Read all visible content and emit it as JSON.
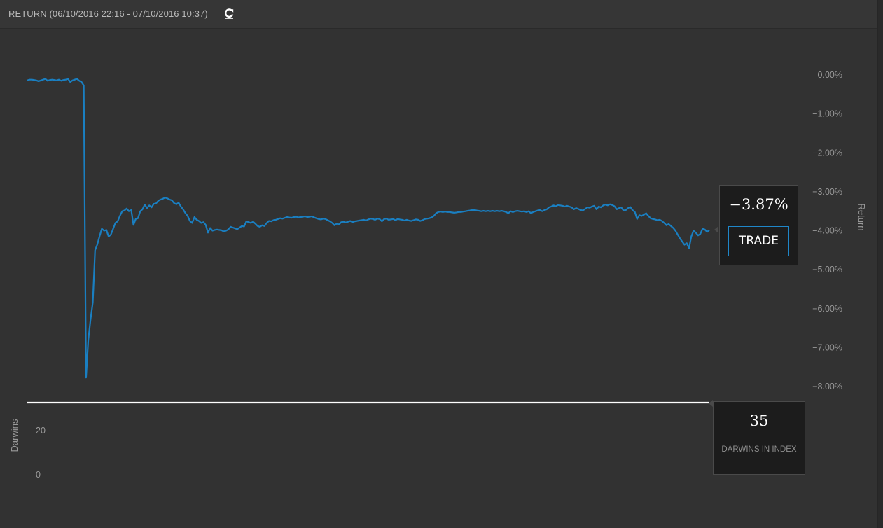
{
  "header": {
    "title": "RETURN (06/10/2016 22:16 - 07/10/2016 10:37)",
    "refresh_icon": "refresh-icon"
  },
  "return_box": {
    "value": "−3.87%",
    "trade_label": "TRADE"
  },
  "darwins_box": {
    "count": "35",
    "label": "DARWINS IN INDEX"
  },
  "colors": {
    "line": "#1a7fc1",
    "background": "#323232",
    "darwins_line": "#ffffff"
  },
  "chart_data": [
    {
      "type": "line",
      "ylabel": "Return",
      "ylim": [
        -8,
        0
      ],
      "y_ticks": [
        "0.00%",
        "−1.00%",
        "−2.00%",
        "−3.00%",
        "−4.00%",
        "−5.00%",
        "−6.00%",
        "−7.00%",
        "−8.00%"
      ],
      "y_tick_values": [
        0,
        -1,
        -2,
        -3,
        -4,
        -5,
        -6,
        -7,
        -8
      ],
      "grid": false,
      "series": [
        {
          "values": [
            -0.14,
            -0.12,
            -0.12,
            -0.13,
            -0.14,
            -0.16,
            -0.14,
            -0.12,
            -0.1,
            -0.15,
            -0.13,
            -0.12,
            -0.13,
            -0.14,
            -0.12,
            -0.15,
            -0.13,
            -0.12,
            -0.1,
            -0.18,
            -0.14,
            -0.12,
            -0.1,
            -0.15,
            -0.18,
            -0.27,
            -7.77,
            -6.8,
            -6.28,
            -5.84,
            -4.5,
            -4.35,
            -4.14,
            -3.95,
            -4.0,
            -3.98,
            -4.15,
            -4.1,
            -3.95,
            -3.8,
            -3.76,
            -3.62,
            -3.5,
            -3.48,
            -3.43,
            -3.5,
            -3.47,
            -3.85,
            -3.7,
            -3.68,
            -3.5,
            -3.45,
            -3.33,
            -3.42,
            -3.35,
            -3.4,
            -3.31,
            -3.3,
            -3.23,
            -3.2,
            -3.18,
            -3.15,
            -3.17,
            -3.2,
            -3.22,
            -3.29,
            -3.32,
            -3.28,
            -3.38,
            -3.45,
            -3.55,
            -3.62,
            -3.75,
            -3.8,
            -3.65,
            -3.72,
            -3.75,
            -3.8,
            -3.78,
            -3.85,
            -4.05,
            -3.93,
            -4.0,
            -3.98,
            -3.97,
            -3.98,
            -3.99,
            -4.02,
            -4.0,
            -3.97,
            -3.9,
            -3.92,
            -3.94,
            -3.96,
            -3.92,
            -3.88,
            -3.89,
            -3.76,
            -3.78,
            -3.8,
            -3.77,
            -3.82,
            -3.88,
            -3.9,
            -3.86,
            -3.88,
            -3.8,
            -3.75,
            -3.76,
            -3.73,
            -3.72,
            -3.7,
            -3.68,
            -3.69,
            -3.67,
            -3.65,
            -3.66,
            -3.67,
            -3.65,
            -3.64,
            -3.66,
            -3.65,
            -3.64,
            -3.63,
            -3.65,
            -3.64,
            -3.63,
            -3.66,
            -3.68,
            -3.7,
            -3.71,
            -3.69,
            -3.7,
            -3.73,
            -3.76,
            -3.8,
            -3.86,
            -3.82,
            -3.84,
            -3.78,
            -3.77,
            -3.79,
            -3.77,
            -3.75,
            -3.78,
            -3.76,
            -3.75,
            -3.74,
            -3.73,
            -3.72,
            -3.74,
            -3.71,
            -3.69,
            -3.7,
            -3.72,
            -3.69,
            -3.7,
            -3.76,
            -3.7,
            -3.69,
            -3.72,
            -3.71,
            -3.7,
            -3.73,
            -3.7,
            -3.71,
            -3.72,
            -3.74,
            -3.72,
            -3.74,
            -3.75,
            -3.73,
            -3.71,
            -3.72,
            -3.75,
            -3.73,
            -3.7,
            -3.69,
            -3.68,
            -3.66,
            -3.62,
            -3.55,
            -3.52,
            -3.51,
            -3.52,
            -3.51,
            -3.52,
            -3.52,
            -3.53,
            -3.54,
            -3.53,
            -3.52,
            -3.52,
            -3.51,
            -3.5,
            -3.49,
            -3.48,
            -3.47,
            -3.47,
            -3.48,
            -3.49,
            -3.5,
            -3.49,
            -3.5,
            -3.49,
            -3.5,
            -3.49,
            -3.5,
            -3.49,
            -3.5,
            -3.49,
            -3.5,
            -3.52,
            -3.55,
            -3.5,
            -3.52,
            -3.5,
            -3.49,
            -3.5,
            -3.51,
            -3.5,
            -3.52,
            -3.5,
            -3.55,
            -3.52,
            -3.5,
            -3.48,
            -3.47,
            -3.5,
            -3.47,
            -3.45,
            -3.4,
            -3.38,
            -3.35,
            -3.37,
            -3.34,
            -3.35,
            -3.36,
            -3.38,
            -3.36,
            -3.38,
            -3.4,
            -3.45,
            -3.42,
            -3.44,
            -3.47,
            -3.48,
            -3.44,
            -3.4,
            -3.41,
            -3.38,
            -3.36,
            -3.45,
            -3.38,
            -3.4,
            -3.35,
            -3.33,
            -3.35,
            -3.32,
            -3.34,
            -3.37,
            -3.45,
            -3.42,
            -3.4,
            -3.48,
            -3.47,
            -3.42,
            -3.39,
            -3.47,
            -3.52,
            -3.7,
            -3.6,
            -3.62,
            -3.59,
            -3.55,
            -3.62,
            -3.68,
            -3.7,
            -3.71,
            -3.73,
            -3.72,
            -3.75,
            -3.8,
            -3.86,
            -3.83,
            -3.88,
            -3.93,
            -4.0,
            -4.1,
            -4.2,
            -4.28,
            -4.36,
            -4.32,
            -4.45,
            -4.15,
            -4.0,
            -4.05,
            -4.12,
            -4.08,
            -3.95,
            -3.97,
            -4.03,
            -3.98
          ]
        }
      ]
    },
    {
      "type": "line",
      "ylabel": "Darwins",
      "y_ticks": [
        "20",
        "0"
      ],
      "y_tick_values": [
        20,
        0
      ],
      "ylim": [
        0,
        35
      ],
      "grid": false,
      "series": [
        {
          "values": [
            35,
            35
          ]
        }
      ]
    }
  ]
}
